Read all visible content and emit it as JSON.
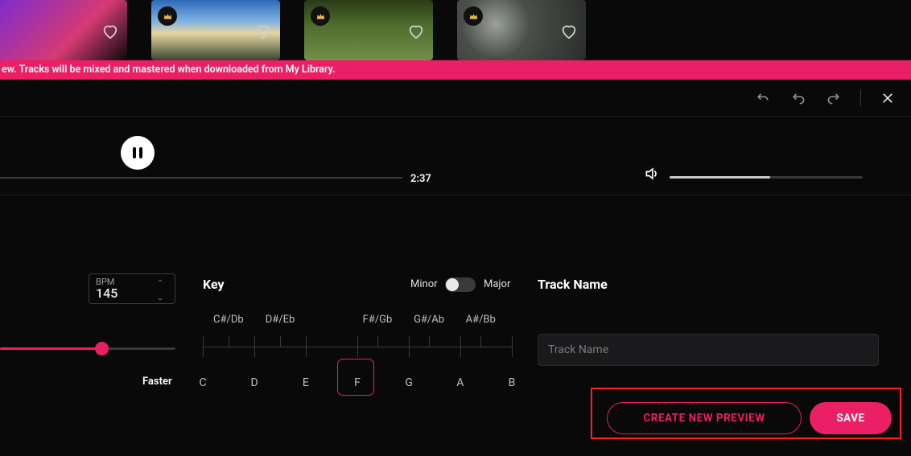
{
  "notification": {
    "text": "ew. Tracks will be mixed and mastered when downloaded from My Library."
  },
  "player": {
    "time": "2:37",
    "volume_pct": 52
  },
  "bpm": {
    "label": "BPM",
    "value": "145",
    "faster_label": "Faster",
    "fill_pct": 58
  },
  "key": {
    "label": "Key",
    "minor_label": "Minor",
    "major_label": "Major",
    "toggle_state": "minor",
    "sharps": [
      "C#/Db",
      "D#/Eb",
      "F#/Gb",
      "G#/Ab",
      "A#/Bb"
    ],
    "naturals": [
      "C",
      "D",
      "E",
      "F",
      "G",
      "A",
      "B"
    ],
    "selected": "F"
  },
  "track": {
    "label": "Track Name",
    "placeholder": "Track Name",
    "value": ""
  },
  "buttons": {
    "create": "CREATE NEW PREVIEW",
    "save": "SAVE"
  },
  "cards": [
    {
      "title": "",
      "gradient": "linear-gradient(135deg,#7d2bd0,#d63a73 60%,#0a0a0a)",
      "silhouette": true
    },
    {
      "title": "",
      "gradient": "linear-gradient(180deg,#2e6ab8 0%,#7fb2e2 35%,#e7d6a2 55%,#3a452e 100%)"
    },
    {
      "title": "",
      "gradient": "linear-gradient(180deg,#2a3a18 0%,#4d6b2a 40%,#73904a 100%)"
    },
    {
      "title": "",
      "gradient": "radial-gradient(circle at 30% 40%,#9aa09a 0%,#4a4f4a 35%,#2a2d2a 100%)"
    }
  ]
}
